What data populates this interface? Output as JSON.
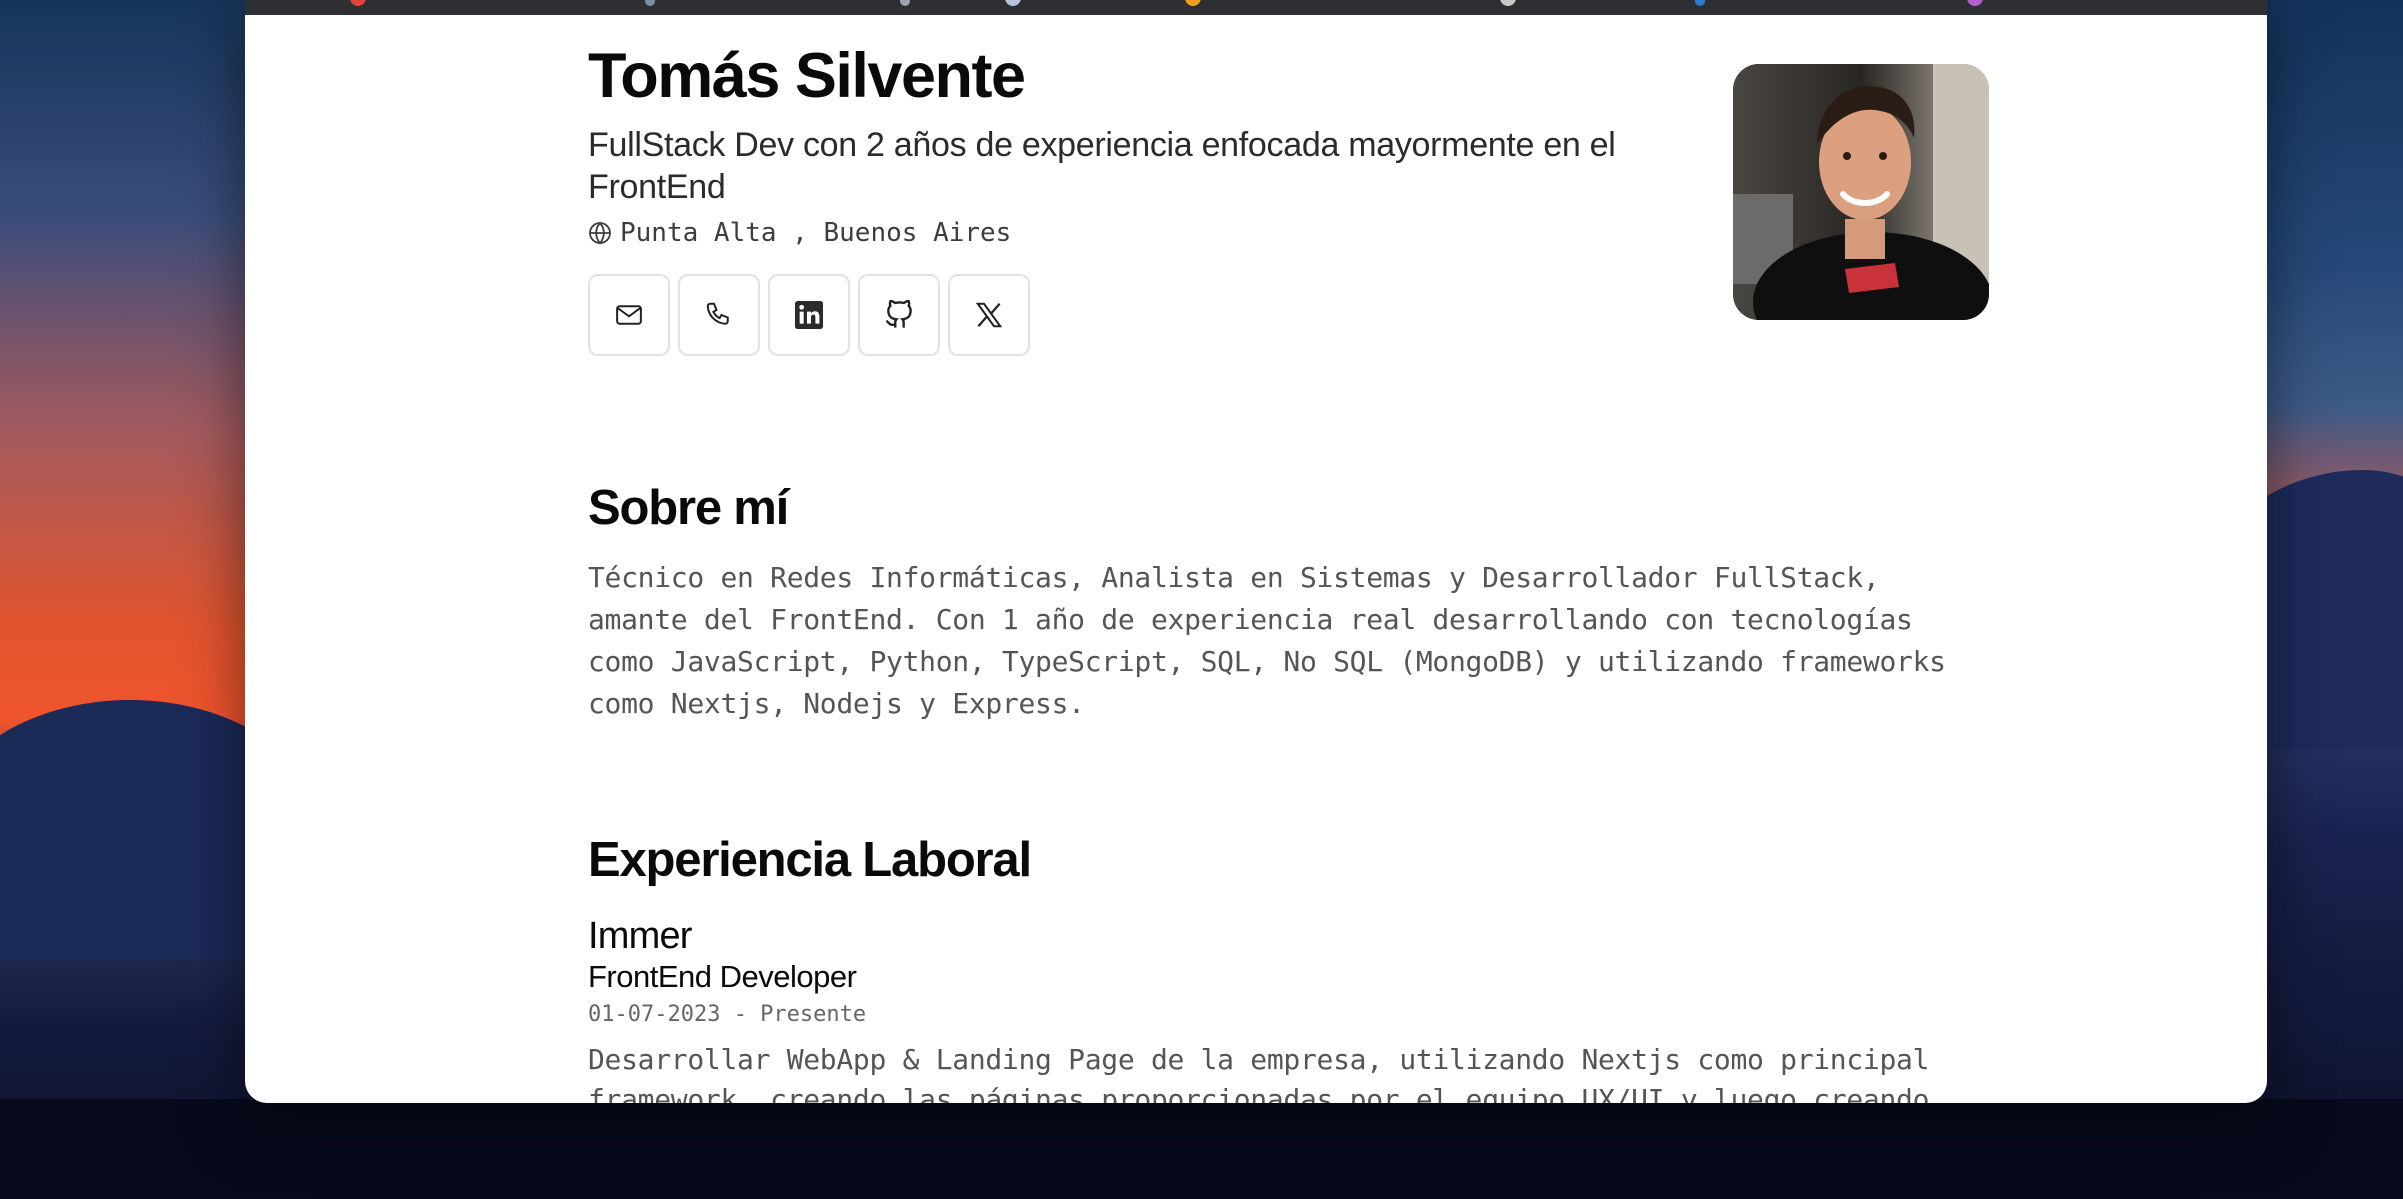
{
  "profile": {
    "name": "Tomás Silvente",
    "tagline": "FullStack Dev con 2 años de experiencia enfocada mayormente en el FrontEnd",
    "location": "Punta Alta , Buenos Aires"
  },
  "contacts": [
    {
      "icon": "mail-icon"
    },
    {
      "icon": "phone-icon"
    },
    {
      "icon": "linkedin-icon"
    },
    {
      "icon": "github-icon"
    },
    {
      "icon": "x-icon"
    }
  ],
  "about": {
    "title": "Sobre mí",
    "text": "Técnico en Redes Informáticas, Analista en Sistemas y Desarrollador FullStack, amante del FrontEnd. Con 1 año de experiencia real desarrollando con tecnologías como JavaScript, Python, TypeScript, SQL, No SQL (MongoDB) y utilizando frameworks como Nextjs, Nodejs y Express."
  },
  "experience": {
    "title": "Experiencia Laboral",
    "jobs": [
      {
        "company": "Immer",
        "role": "FrontEnd Developer",
        "dates": "01-07-2023 - Presente",
        "description": "Desarrollar WebApp & Landing Page de la empresa, utilizando Nextjs como principal framework, creando las páginas proporcionadas por el equipo UX/UI y luego creando"
      }
    ]
  },
  "colors": {
    "text": "#0a0a0a",
    "muted": "#555555",
    "border": "#e2e2e2"
  }
}
